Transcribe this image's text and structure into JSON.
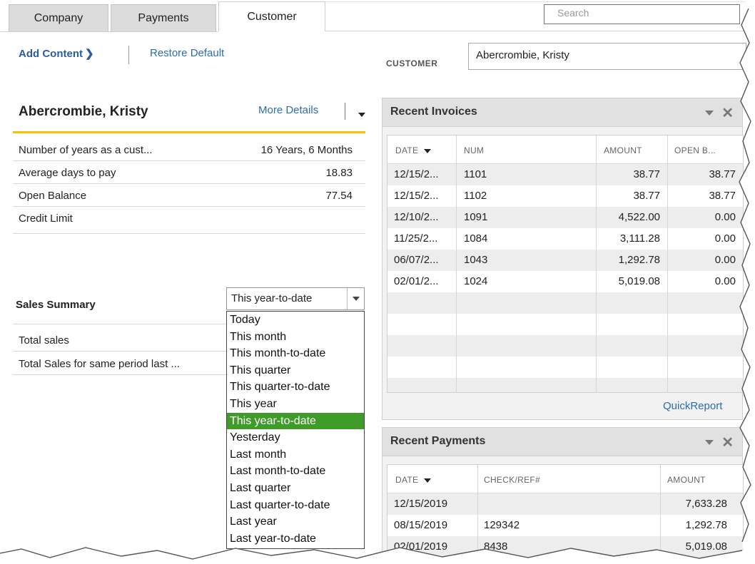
{
  "tabs": [
    {
      "label": "Company",
      "active": false
    },
    {
      "label": "Payments",
      "active": false
    },
    {
      "label": "Customer",
      "active": true
    }
  ],
  "search": {
    "placeholder": "Search"
  },
  "toolbar": {
    "add_content": "Add Content",
    "restore_default": "Restore Default"
  },
  "customer_selector": {
    "label": "CUSTOMER",
    "value": "Abercrombie, Kristy"
  },
  "customer": {
    "name": "Abercrombie, Kristy",
    "more_details": "More Details",
    "info": [
      {
        "label": "Number of years as a cust...",
        "value": "16 Years, 6 Months"
      },
      {
        "label": "Average days to pay",
        "value": "18.83"
      },
      {
        "label": "Open Balance",
        "value": "77.54"
      },
      {
        "label": "Credit Limit",
        "value": ""
      }
    ]
  },
  "sales_summary": {
    "title": "Sales Summary",
    "period": "This year-to-date",
    "rows": [
      {
        "label": "Total sales"
      },
      {
        "label": "Total Sales for same period last ..."
      }
    ],
    "options": [
      "Today",
      "This month",
      "This month-to-date",
      "This quarter",
      "This quarter-to-date",
      "This year",
      "This year-to-date",
      "Yesterday",
      "Last month",
      "Last month-to-date",
      "Last quarter",
      "Last quarter-to-date",
      "Last year",
      "Last year-to-date"
    ],
    "selected_option": "This year-to-date"
  },
  "recent_invoices": {
    "title": "Recent Invoices",
    "columns": [
      "DATE",
      "NUM",
      "AMOUNT",
      "OPEN B..."
    ],
    "rows": [
      {
        "date": "12/15/2...",
        "num": "1101",
        "amount": "38.77",
        "open": "38.77"
      },
      {
        "date": "12/15/2...",
        "num": "1102",
        "amount": "38.77",
        "open": "38.77"
      },
      {
        "date": "12/10/2...",
        "num": "1091",
        "amount": "4,522.00",
        "open": "0.00"
      },
      {
        "date": "11/25/2...",
        "num": "1084",
        "amount": "3,111.28",
        "open": "0.00"
      },
      {
        "date": "06/07/2...",
        "num": "1043",
        "amount": "1,292.78",
        "open": "0.00"
      },
      {
        "date": "02/01/2...",
        "num": "1024",
        "amount": "5,019.08",
        "open": "0.00"
      }
    ],
    "quickreport": "QuickReport"
  },
  "recent_payments": {
    "title": "Recent Payments",
    "columns": [
      "DATE",
      "CHECK/REF#",
      "AMOUNT"
    ],
    "rows": [
      {
        "date": "12/15/2019",
        "ref": "",
        "amount": "7,633.28"
      },
      {
        "date": "08/15/2019",
        "ref": "129342",
        "amount": "1,292.78"
      },
      {
        "date": "02/01/2019",
        "ref": "8438",
        "amount": "5,019.08"
      }
    ]
  },
  "colors": {
    "accent_line": "#f3c200",
    "selected_option": "#3f9c2b",
    "link": "#2b6cb0"
  }
}
